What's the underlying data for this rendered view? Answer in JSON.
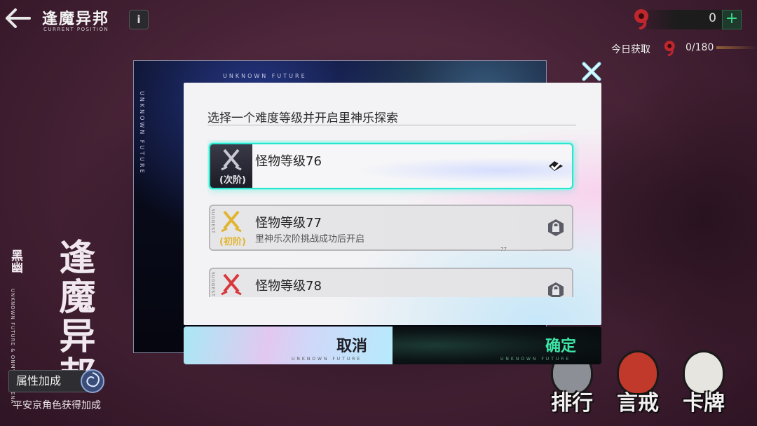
{
  "header": {
    "title": "逢魔异邦",
    "subtitle": "CURRENT POSITION",
    "info_label": "i",
    "back_icon": "arrow-left-icon"
  },
  "currency": {
    "value": "0",
    "add_label": "+",
    "today_label": "今日获取",
    "today_value": "0/180",
    "icon": "magatama-icon"
  },
  "decor": {
    "calligraphy_main": "逢魔异邦",
    "calligraphy_side": "黑幽",
    "calligraphy_en": "UNKNOWN FUTURE & ONMYOJI ARENA"
  },
  "attribute": {
    "button_label": "属性加成",
    "description": "平安京角色获得加成"
  },
  "nav": [
    {
      "label": "排行",
      "color": "#8d8f96"
    },
    {
      "label": "言戒",
      "color": "#c0392b"
    },
    {
      "label": "卡牌",
      "color": "#e7e5df"
    }
  ],
  "panel": {
    "back_label": "UNKNOWN FUTURE",
    "side_label": "UNKNOWN FUTURE"
  },
  "dialog": {
    "title": "选择一个难度等级并开启里神乐探索",
    "levels": [
      {
        "name": "怪物等级76",
        "tag": "(次阶)",
        "desc": "",
        "state": "selected",
        "accent": "#6b6f86"
      },
      {
        "name": "怪物等级77",
        "tag": "(初阶)",
        "desc": "里神乐次阶挑战成功后开启",
        "state": "locked",
        "accent": "#e2b531",
        "suggest": "SUGGEST"
      },
      {
        "name": "怪物等级78",
        "tag": "",
        "desc": "",
        "state": "locked",
        "accent": "#d9383d",
        "suggest": "SUGGEST"
      }
    ],
    "scroll_marker": "77",
    "cancel_label": "取消",
    "confirm_label": "确定",
    "button_sub": "UNKNOWN FUTURE"
  }
}
